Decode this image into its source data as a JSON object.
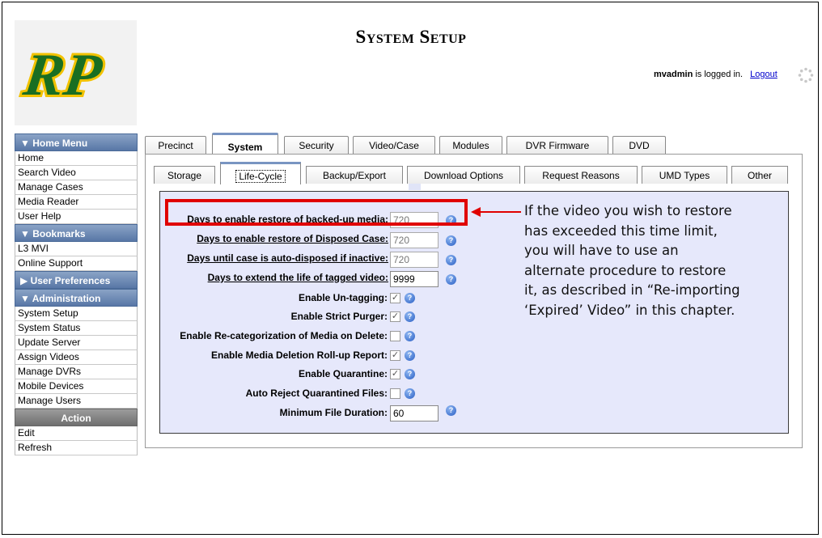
{
  "header": {
    "title": "System Setup",
    "user": "mvadmin",
    "logged_in_text": "is logged in.",
    "logout": "Logout"
  },
  "logo": {
    "text": "RP",
    "color": "#1a6e22",
    "accent": "#f2c200"
  },
  "sidebar": {
    "home_menu": {
      "title": "▼ Home Menu",
      "items": [
        "Home",
        "Search Video",
        "Manage Cases",
        "Media Reader",
        "User Help"
      ]
    },
    "bookmarks": {
      "title": "▼ Bookmarks",
      "items": [
        "L3 MVI",
        "Online Support"
      ]
    },
    "user_preferences": {
      "title": "▶ User Preferences"
    },
    "administration": {
      "title": "▼ Administration",
      "items": [
        "System Setup",
        "System Status",
        "Update Server",
        "Assign Videos",
        "Manage DVRs",
        "Mobile Devices",
        "Manage Users"
      ]
    },
    "action": {
      "title": "Action",
      "items": [
        "Edit",
        "Refresh"
      ]
    }
  },
  "tabs": {
    "primary": [
      "Precinct",
      "System",
      "Security",
      "Video/Case",
      "Modules",
      "DVR Firmware",
      "DVD"
    ],
    "primary_active": "System",
    "secondary": [
      "Storage",
      "Life-Cycle",
      "Backup/Export",
      "Download Options",
      "Request Reasons",
      "UMD Types",
      "Other"
    ],
    "secondary_active": "Life-Cycle"
  },
  "form": {
    "restore_backed_up": {
      "label": "Days to enable restore of backed-up media:",
      "value": "720"
    },
    "restore_disposed": {
      "label": "Days to enable restore of Disposed Case:",
      "value": "720"
    },
    "auto_disposed": {
      "label": "Days until case is auto-disposed if inactive:",
      "value": "720"
    },
    "extend_tagged": {
      "label": "Days to extend the life of tagged video:",
      "value": "9999"
    },
    "untagging": {
      "label": "Enable Un-tagging:",
      "checked": true
    },
    "strict_purger": {
      "label": "Enable Strict Purger:",
      "checked": true
    },
    "recategorization": {
      "label": "Enable Re-categorization of Media on Delete:",
      "checked": false
    },
    "rollup_report": {
      "label": "Enable Media Deletion Roll-up Report:",
      "checked": true
    },
    "quarantine": {
      "label": "Enable Quarantine:",
      "checked": true
    },
    "auto_reject": {
      "label": "Auto Reject Quarantined Files:",
      "checked": false
    },
    "min_duration": {
      "label": "Minimum File Duration:",
      "value": "60"
    }
  },
  "callout": {
    "text": "If the video you wish to restore has exceeded this time limit, you will have to use an alternate procedure to restore it, as described in “Re-importing ‘Expired’ Video” in this chapter."
  },
  "colors": {
    "highlight": "#e00000",
    "panel": "#e6e8fb",
    "sidebar_header": "#5877a6"
  }
}
